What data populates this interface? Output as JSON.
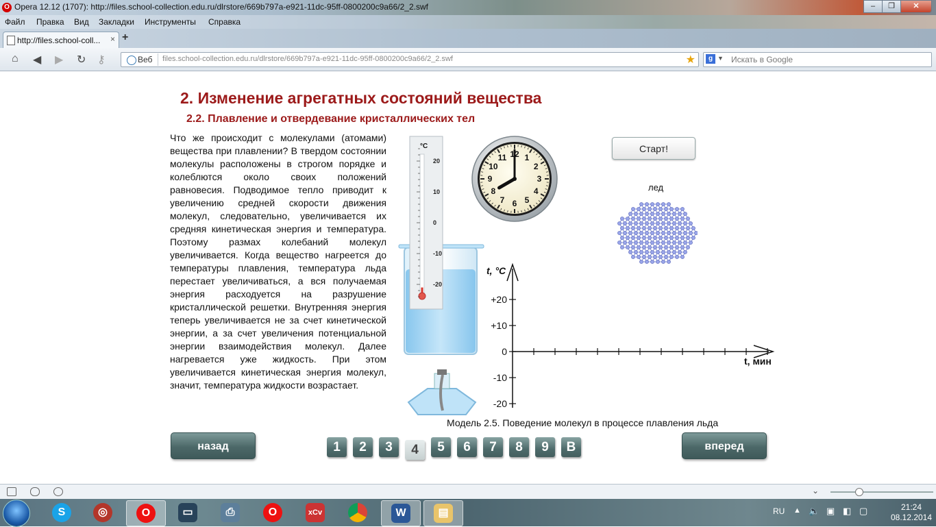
{
  "window": {
    "title": "Opera 12.12 (1707): http://files.school-collection.edu.ru/dlrstore/669b797a-e921-11dc-95ff-0800200c9a66/2_2.swf",
    "minimize": "–",
    "maximize": "❐",
    "close": "✕"
  },
  "menu": [
    "Файл",
    "Правка",
    "Вид",
    "Закладки",
    "Инструменты",
    "Справка"
  ],
  "tab": {
    "label": "http://files.school-coll...",
    "close": "×",
    "new": "+"
  },
  "nav": {
    "back": "◀",
    "forward": "▶",
    "reload": "↻",
    "home": "⌂",
    "web_label": "Веб",
    "url": "files.school-collection.edu.ru/dlrstore/669b797a-e921-11dc-95ff-0800200c9a66/2_2.swf",
    "search_placeholder": "Искать в Google",
    "search_engine": "g"
  },
  "page": {
    "title": "2. Изменение агрегатных состояний вещества",
    "subtitle": "2.2. Плавление и отвердевание кристаллических тел",
    "paragraph": "Что же происходит с молекулами (атомами) вещества при плавлении? В твердом состоянии молекулы расположены в строгом порядке и колеблются около своих положений равновесия. Подводимое тепло приводит к увеличению средней скорости движения молекул, следовательно, увеличивается их средняя кинетическая энергия и температура. Поэтому размах колебаний молекул увеличивается. Когда вещество нагреется до температуры плавления, температура льда перестает увеличиваться, а вся получаемая энергия расходуется на разрушение кристаллической решетки. Внутренняя энергия теперь увеличивается не за счет кинетической энергии, а за счет увеличения потенциальной энергии взаимодействия молекул. Далее нагревается уже жидкость. При этом увеличивается кинетическая энергия молекул, значит, температура жидкости возрастает.",
    "start_button": "Старт!",
    "ice_label": "лед",
    "caption": "Модель 2.5. Поведение молекул в процессе плавления льда",
    "back_button": "назад",
    "forward_button": "вперед",
    "pages": [
      "1",
      "2",
      "3",
      "4",
      "5",
      "6",
      "7",
      "8",
      "9",
      "B"
    ],
    "active_page": "4"
  },
  "thermometer": {
    "unit": "°C",
    "ticks": [
      "20",
      "10",
      "0",
      "-10",
      "-20"
    ],
    "reading": -21
  },
  "clock": {
    "numbers": [
      "12",
      "1",
      "2",
      "3",
      "4",
      "5",
      "6",
      "7",
      "8",
      "9",
      "10",
      "11"
    ],
    "hour": 8,
    "minute": 0
  },
  "graph": {
    "ylabel": "t, °C",
    "xlabel": "t, мин",
    "yticks": [
      "+20",
      "+10",
      "0",
      "-10",
      "-20"
    ]
  },
  "taskbar": {
    "lang": "RU",
    "time": "21:24",
    "date": "08.12.2014",
    "apps": [
      "skype",
      "photo",
      "opera",
      "monitor",
      "scanner",
      "opera",
      "xcv",
      "chrome",
      "word",
      "explorer"
    ]
  },
  "colors": {
    "heading": "#9c1a1a",
    "button": "#4e6b6b",
    "water": "#9cd0f2"
  }
}
